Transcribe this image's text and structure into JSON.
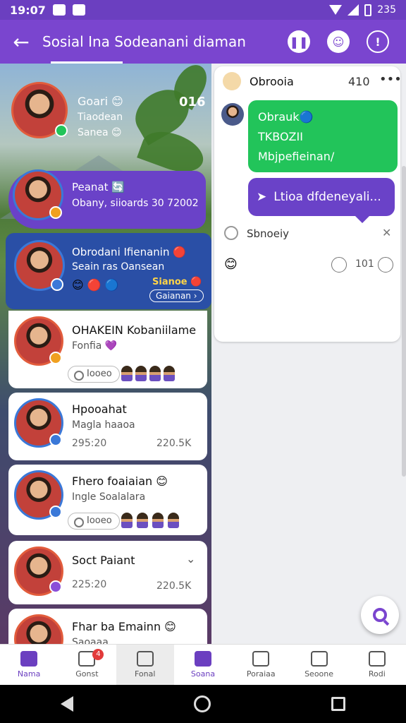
{
  "status_bar": {
    "time": "19:07",
    "battery": "235"
  },
  "app_bar": {
    "title": "Sosial Ina Sodeanani diaman"
  },
  "story_cards": [
    {
      "name": "Goari 😊",
      "line1": "Tiaodean",
      "line2": "Sanea 😊",
      "count": "016"
    },
    {
      "name": "Peanat 🔄",
      "line1": "Obany, siioards 30 72002"
    },
    {
      "name": "Obrodani Ifienanin 🔴",
      "line1": "Seain ras Oansean",
      "tag": "Sianoe 🔴",
      "link": "Gaianan ›"
    }
  ],
  "contacts": [
    {
      "name": "OHAKEIN Kobaniilame",
      "sub": "Fonfia 💜",
      "pill": "Iooeo"
    },
    {
      "name": "Hpooahat",
      "sub": "Magla haaoa",
      "meta_left": "295:20",
      "meta_right": "220.5K"
    },
    {
      "name": "Fhero foaiaian 😊",
      "sub": "Ingle Soalalara",
      "pill": "Iooeo"
    },
    {
      "name": "Soct Paiant",
      "meta_left": "225:20",
      "meta_right": "220.5K"
    },
    {
      "name": "Fhar ba Emainn 😊",
      "sub": "Saoaaa"
    }
  ],
  "chat": {
    "header_title": "Obrooia",
    "header_count": "410",
    "bubble_green": [
      "Obrauk🔵",
      "TKBOZII",
      "Mbjpefieinan/"
    ],
    "bubble_purple": "Ltioa dfdeneyali...",
    "reply_label": "Sbnoeiy",
    "footer_left": "101",
    "footer_count": "101"
  },
  "bottom_nav": [
    {
      "label": "Nama"
    },
    {
      "label": "Gonst",
      "badge": "4"
    },
    {
      "label": "Fonal"
    },
    {
      "label": "Soana"
    },
    {
      "label": "Poraiaa"
    },
    {
      "label": "Seoone"
    },
    {
      "label": "Rodi"
    }
  ],
  "colors": {
    "primary": "#7a45cf",
    "green": "#22c45a",
    "story_purple": "#6a42c8",
    "story_blue": "#2a4fa6"
  }
}
